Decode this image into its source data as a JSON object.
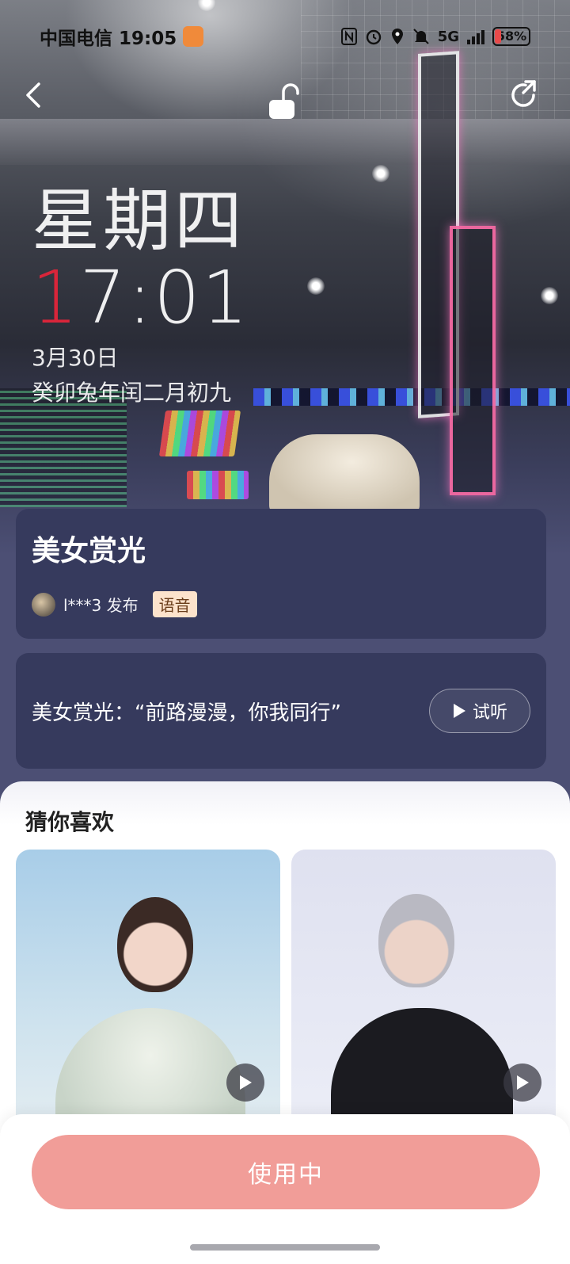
{
  "status_bar": {
    "carrier_time": "中国电信 19:05",
    "network_type": "5G",
    "battery": "58%"
  },
  "icons": {
    "back": "chevron-left-icon",
    "lock": "unlock-icon",
    "share": "share-icon",
    "play": "play-icon"
  },
  "wallpaper": {
    "weekday": "星期四",
    "time_first": "1",
    "time_rest": "7:01",
    "date": "3月30日",
    "lunar_date": "癸卯兔年闰二月初九"
  },
  "theme": {
    "title": "美女赏光",
    "author": "l***3 发布",
    "tag": "语音"
  },
  "audio": {
    "description": "美女赏光：“前路漫漫，你我同行”",
    "preview_label": "试听"
  },
  "recommendations": {
    "title": "猜你喜欢"
  },
  "footer": {
    "action_label": "使用中"
  },
  "colors": {
    "card_bg": "#363a5d",
    "page_bg": "#4c4f74",
    "action_button": "#f19d98",
    "clock_accent": "#d9253a",
    "tag_bg": "#fde3cc"
  }
}
